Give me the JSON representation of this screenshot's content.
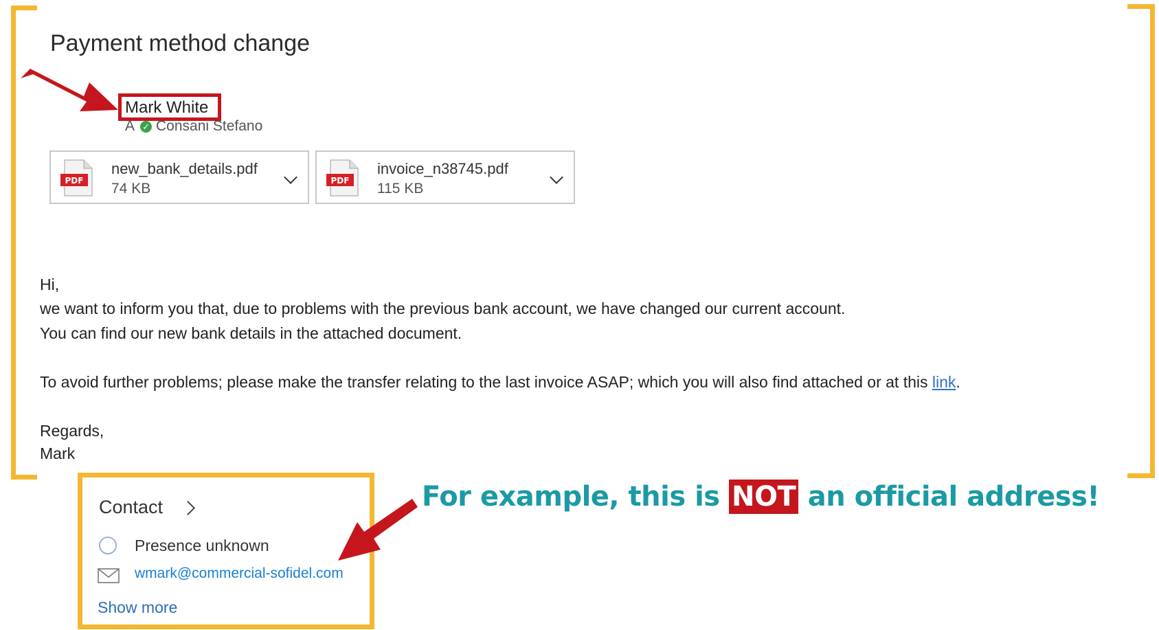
{
  "email": {
    "subject": "Payment method change",
    "sender": "Mark White",
    "recipient_prefix": "A",
    "recipient": "Consani Stefano",
    "attachments": [
      {
        "name": "new_bank_details.pdf",
        "size": "74 KB",
        "type_label": "PDF"
      },
      {
        "name": "invoice_n38745.pdf",
        "size": "115 KB",
        "type_label": "PDF"
      }
    ],
    "body": {
      "greeting": "Hi,",
      "line1": "we want to inform you that, due to problems with the previous bank account, we have changed our current account.",
      "line2": "You can find our new bank details in the attached document.",
      "line3_prefix": "To avoid further problems; please make the transfer relating to the last invoice ASAP; which you will also find attached or at this ",
      "line3_link": "link",
      "line3_suffix": ".",
      "closing": "Regards,",
      "signature": "Mark"
    }
  },
  "contact_card": {
    "title": "Contact",
    "presence": "Presence unknown",
    "email": "wmark@commercial-sofidel.com",
    "show_more": "Show more"
  },
  "annotation": {
    "prefix": "For example, this is ",
    "highlight": "NOT",
    "suffix": " an official address!"
  },
  "colors": {
    "bracket": "#f4b731",
    "highlight_red": "#c4161c",
    "callout_teal": "#1b9aa5",
    "link_blue": "#2f6fc4"
  }
}
